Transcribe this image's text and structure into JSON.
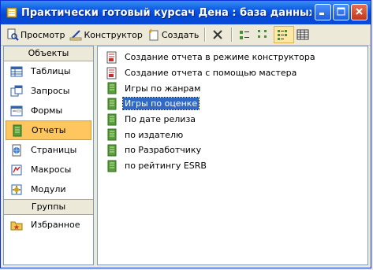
{
  "window": {
    "title": "Практически готовый курсач Дена : база данных (форм..."
  },
  "toolbar": {
    "preview_label": "Просмотр",
    "design_label": "Конструктор",
    "create_label": "Создать"
  },
  "sidebar": {
    "objects_header": "Объекты",
    "items": [
      {
        "label": "Таблицы",
        "icon": "table-icon"
      },
      {
        "label": "Запросы",
        "icon": "query-icon"
      },
      {
        "label": "Формы",
        "icon": "form-icon"
      },
      {
        "label": "Отчеты",
        "icon": "report-icon",
        "selected": true
      },
      {
        "label": "Страницы",
        "icon": "page-icon"
      },
      {
        "label": "Макросы",
        "icon": "macro-icon"
      },
      {
        "label": "Модули",
        "icon": "module-icon"
      }
    ],
    "groups_header": "Группы",
    "group_items": [
      {
        "label": "Избранное",
        "icon": "favorites-icon"
      }
    ]
  },
  "list": {
    "items": [
      {
        "label": "Создание отчета в режиме конструктора",
        "icon": "wizard-icon"
      },
      {
        "label": "Создание отчета с помощью мастера",
        "icon": "wizard-icon"
      },
      {
        "label": "Игры по жанрам",
        "icon": "report-icon"
      },
      {
        "label": "Игры по оценке",
        "icon": "report-icon",
        "selected": true
      },
      {
        "label": "По дате релиза",
        "icon": "report-icon"
      },
      {
        "label": "по издателю",
        "icon": "report-icon"
      },
      {
        "label": "по Разработчику",
        "icon": "report-icon"
      },
      {
        "label": "по рейтингу ESRB",
        "icon": "report-icon"
      }
    ]
  },
  "colors": {
    "titlebar": "#0a58e4",
    "selection": "#316ac5",
    "sidebar_selected": "#ffc660"
  }
}
